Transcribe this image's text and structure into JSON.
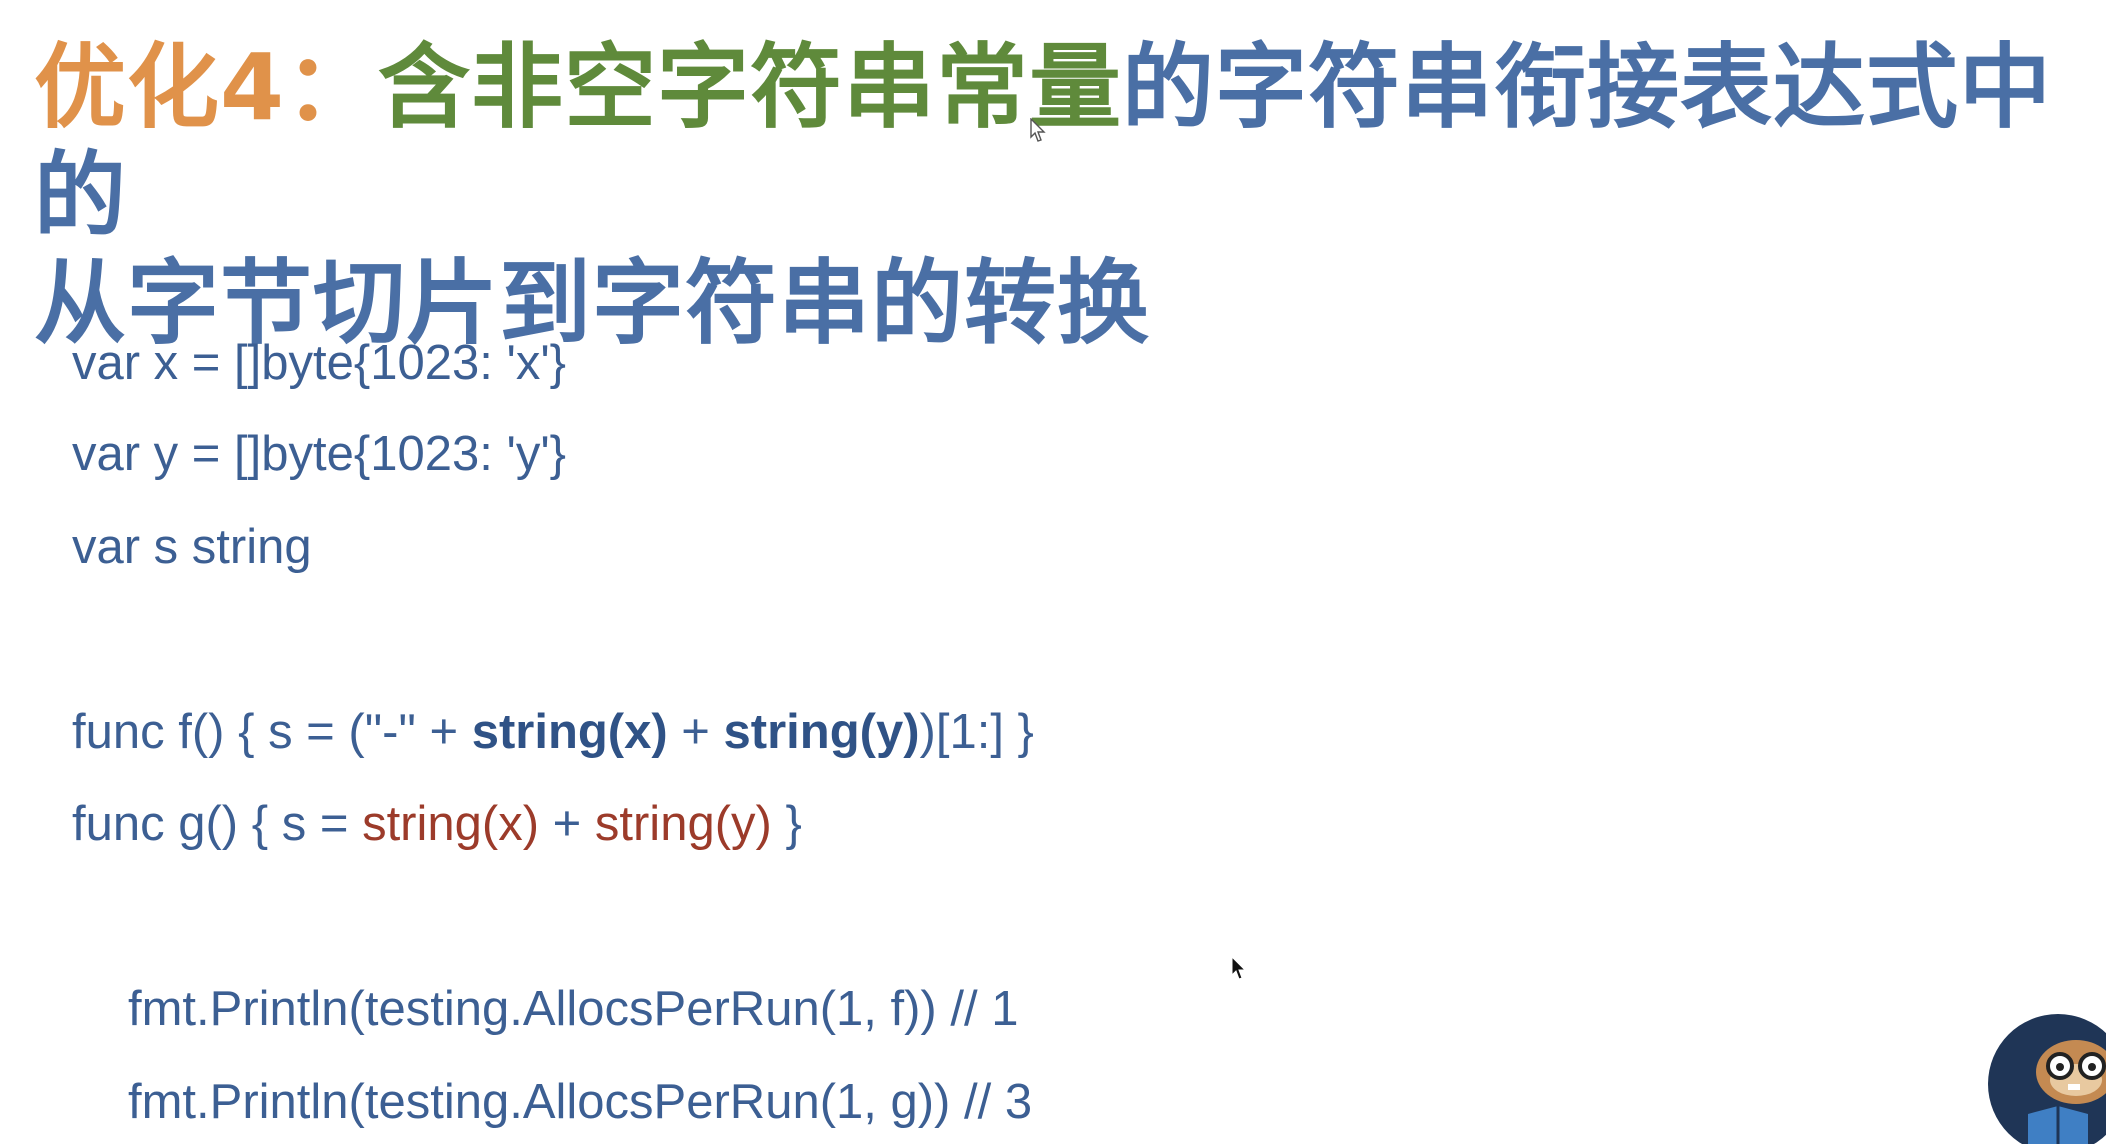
{
  "title": {
    "prefix": "优化4：",
    "green_part": "含非空字符串常量",
    "blue_part_line1": "的字符串衔接表达式中的",
    "line2": "从字节切片到字符串的转换"
  },
  "code": {
    "l1": "var x = []byte{1023: 'x'}",
    "l2": "var y = []byte{1023: 'y'}",
    "l3": "var s string",
    "f_a": "func f() { s = (\"-\" + ",
    "f_b": "string(x)",
    "f_c": " + ",
    "f_d": "string(y)",
    "f_e": ")[1:] }",
    "g_a": "func g() { s = ",
    "g_b": "string(x)",
    "g_c": " + ",
    "g_d": "string(y)",
    "g_e": " }",
    "p1": "fmt.Println(testing.AllocsPerRun(1, f)) // 1",
    "p2": "fmt.Println(testing.AllocsPerRun(1, g)) // 3"
  },
  "colors": {
    "orange": "#e0924a",
    "green": "#5f8a3b",
    "blue": "#4a6fa5",
    "code_blue": "#3c5f93",
    "red": "#9c3b2a"
  },
  "icons": {
    "cursor": "mouse-pointer-icon",
    "mascot": "go-gopher-mascot"
  }
}
